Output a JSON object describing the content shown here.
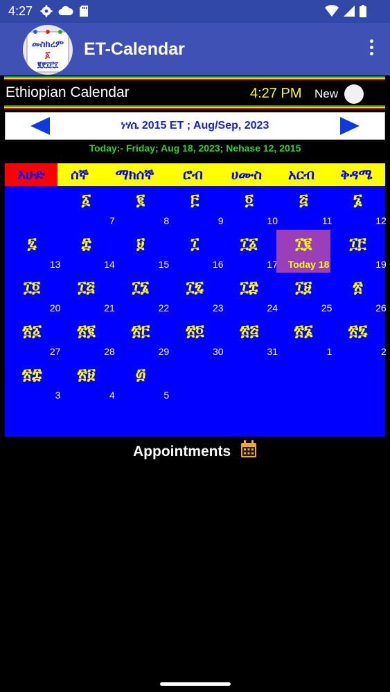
{
  "status_bar": {
    "time": "4:27",
    "left_icons": [
      "gear-icon",
      "cloud-icon",
      "sd-card-icon"
    ],
    "right_icons": [
      "wifi-icon",
      "signal-icon",
      "battery-icon"
    ]
  },
  "app_bar": {
    "title": "ET-Calendar",
    "logo_text_line1": "መስከረም",
    "logo_text_line2": "፩",
    "logo_text_line3": "፪፻፲፫፲"
  },
  "header": {
    "title": "Ethiopian Calendar",
    "clock": "4:27 PM",
    "new_label": "New"
  },
  "month_nav": {
    "label": "ነሃሴ  2015 ET  ;  Aug/Sep, 2023"
  },
  "today_line": "Today:-  Friday; Aug 18, 2023; Nehase 12, 2015",
  "weekdays": [
    "እሁድ",
    "ሰኞ",
    "ማክሰኞ",
    "ሮብ",
    "ሀሙስ",
    "አርብ",
    "ቅዳሜ"
  ],
  "weeks": [
    [
      {
        "eth": "",
        "greg": ""
      },
      {
        "eth": "፩",
        "greg": "7"
      },
      {
        "eth": "፪",
        "greg": "8"
      },
      {
        "eth": "፫",
        "greg": "9"
      },
      {
        "eth": "፬",
        "greg": "10"
      },
      {
        "eth": "፭",
        "greg": "11"
      },
      {
        "eth": "፮",
        "greg": "12"
      }
    ],
    [
      {
        "eth": "፯",
        "greg": "13"
      },
      {
        "eth": "፰",
        "greg": "14"
      },
      {
        "eth": "፱",
        "greg": "15"
      },
      {
        "eth": "፲",
        "greg": "16"
      },
      {
        "eth": "፲፩",
        "greg": "17"
      },
      {
        "eth": "፲፪",
        "greg": "Today 18",
        "today": true
      },
      {
        "eth": "፲፫",
        "greg": "19"
      }
    ],
    [
      {
        "eth": "፲፬",
        "greg": "20"
      },
      {
        "eth": "፲፭",
        "greg": "21"
      },
      {
        "eth": "፲፮",
        "greg": "22"
      },
      {
        "eth": "፲፯",
        "greg": "23"
      },
      {
        "eth": "፲፰",
        "greg": "24"
      },
      {
        "eth": "፲፱",
        "greg": "25"
      },
      {
        "eth": "፳",
        "greg": "26"
      }
    ],
    [
      {
        "eth": "፳፩",
        "greg": "27"
      },
      {
        "eth": "፳፪",
        "greg": "28"
      },
      {
        "eth": "፳፫",
        "greg": "29"
      },
      {
        "eth": "፳፬",
        "greg": "30"
      },
      {
        "eth": "፳፭",
        "greg": "31"
      },
      {
        "eth": "፳፮",
        "greg": "1"
      },
      {
        "eth": "፳፯",
        "greg": "2"
      }
    ],
    [
      {
        "eth": "፳፰",
        "greg": "3"
      },
      {
        "eth": "፳፱",
        "greg": "4"
      },
      {
        "eth": "፴",
        "greg": "5"
      },
      {
        "eth": "",
        "greg": ""
      },
      {
        "eth": "",
        "greg": ""
      },
      {
        "eth": "",
        "greg": ""
      },
      {
        "eth": "",
        "greg": ""
      }
    ]
  ],
  "appointments_label": "Appointments",
  "colors": {
    "app_bar": "#3f51b5",
    "status_bar": "#3248a8",
    "calendar_bg": "#0000ff",
    "weekday_bg": "#ffff00",
    "sunday_bg": "#ff0000",
    "ethiopian_numeral": "#ffff00",
    "today_bg": "#9b3fb8",
    "today_line_text": "#33cc33",
    "clock_text": "#ffff00",
    "flag_green": "#078930",
    "flag_yellow": "#fcdd09",
    "flag_red": "#da121a"
  }
}
